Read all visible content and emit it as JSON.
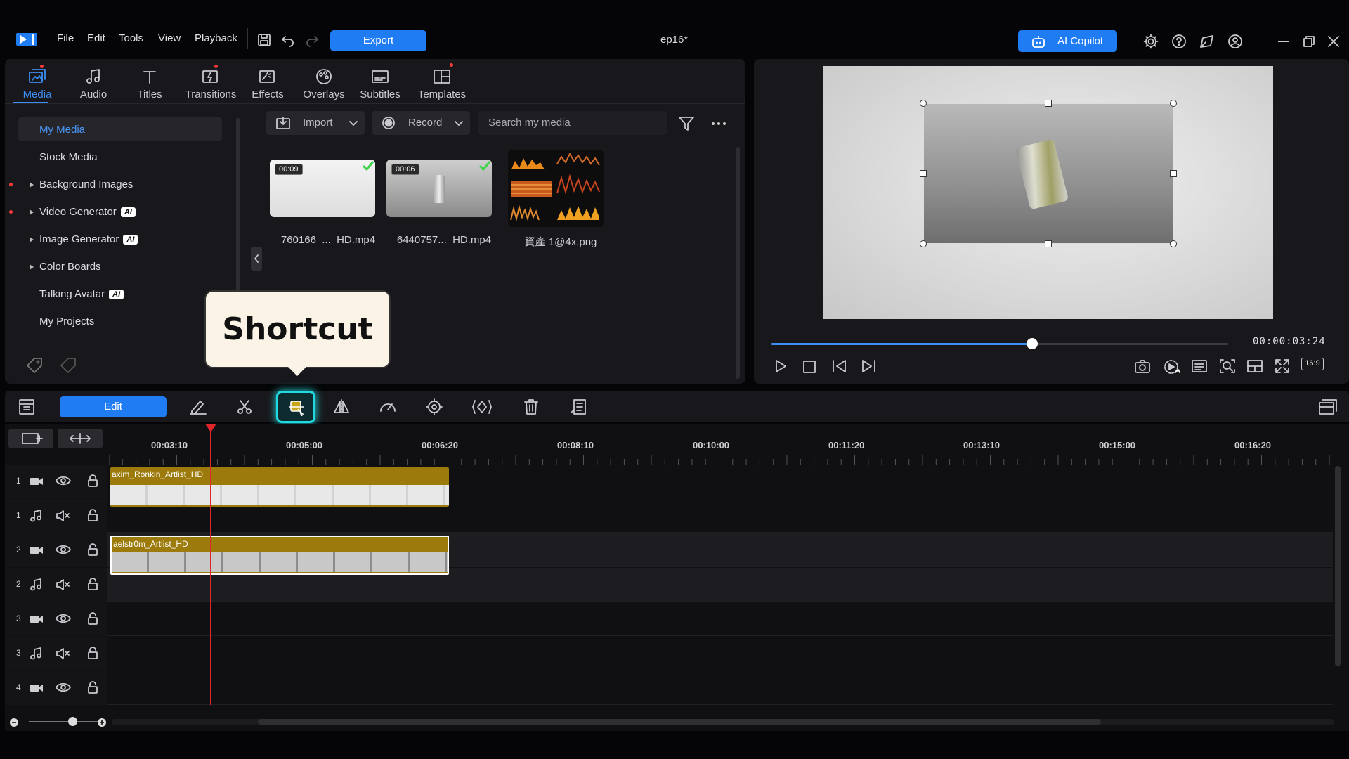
{
  "menu": {
    "file": "File",
    "edit": "Edit",
    "tools": "Tools",
    "view": "View",
    "playback": "Playback"
  },
  "export_label": "Export",
  "doc_title": "ep16*",
  "copilot_label": "AI Copilot",
  "tabs": [
    {
      "label": "Media",
      "icon": "media-icon"
    },
    {
      "label": "Audio",
      "icon": "music-note-icon"
    },
    {
      "label": "Titles",
      "icon": "text-icon"
    },
    {
      "label": "Transitions",
      "icon": "transition-icon"
    },
    {
      "label": "Effects",
      "icon": "effects-icon"
    },
    {
      "label": "Overlays",
      "icon": "overlay-icon"
    },
    {
      "label": "Subtitles",
      "icon": "subtitles-icon"
    },
    {
      "label": "Templates",
      "icon": "templates-icon"
    }
  ],
  "sidebar": {
    "items": [
      {
        "label": "My Media"
      },
      {
        "label": "Stock Media"
      },
      {
        "label": "Background Images"
      },
      {
        "label": "Video Generator",
        "badge": "AI"
      },
      {
        "label": "Image Generator",
        "badge": "AI"
      },
      {
        "label": "Color Boards"
      },
      {
        "label": "Talking Avatar",
        "badge": "AI"
      },
      {
        "label": "My Projects"
      }
    ]
  },
  "media_toolbar": {
    "import_label": "Import",
    "record_label": "Record",
    "search_placeholder": "Search my media"
  },
  "media_items": [
    {
      "name": "760166_..._HD.mp4",
      "duration": "00:09"
    },
    {
      "name": "6440757..._HD.mp4",
      "duration": "00:06"
    },
    {
      "name": "資產 1@4x.png"
    }
  ],
  "tooltip": "Shortcut",
  "preview": {
    "timecode": "00:00:03:24",
    "aspect": "16:9",
    "progress": 0.57
  },
  "edit_label": "Edit",
  "ruler_ticks": [
    "00:03:10",
    "00:05:00",
    "00:06:20",
    "00:08:10",
    "00:10:00",
    "00:11:20",
    "00:13:10",
    "00:15:00",
    "00:16:20"
  ],
  "tracks": [
    {
      "num": "1",
      "type": "video"
    },
    {
      "num": "1",
      "type": "audio"
    },
    {
      "num": "2",
      "type": "video"
    },
    {
      "num": "2",
      "type": "audio"
    },
    {
      "num": "3",
      "type": "video"
    },
    {
      "num": "3",
      "type": "audio"
    },
    {
      "num": "4",
      "type": "video"
    }
  ],
  "clips": [
    {
      "label": "axim_Ronkin_Artlist_HD"
    },
    {
      "label": "aelstr0m_Artlist_HD"
    }
  ],
  "colors": {
    "accent": "#1f7cf2",
    "highlight": "#21d9e0",
    "clip": "#9c7a0c",
    "playhead": "#e0262a"
  }
}
